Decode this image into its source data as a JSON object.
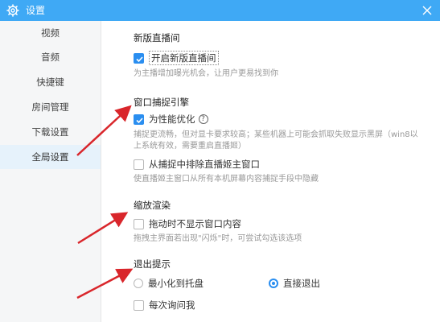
{
  "window": {
    "title": "设置",
    "title_icon": "gear-icon",
    "close_icon": "close-icon"
  },
  "sidebar": {
    "items": [
      {
        "label": "视频",
        "active": false
      },
      {
        "label": "音频",
        "active": false
      },
      {
        "label": "快捷键",
        "active": false
      },
      {
        "label": "房间管理",
        "active": false
      },
      {
        "label": "下载设置",
        "active": false
      },
      {
        "label": "全局设置",
        "active": true
      }
    ]
  },
  "sections": {
    "new_live": {
      "title": "新版直播间",
      "enable_label": "开启新版直播间",
      "enable_checked": true,
      "desc": "为主播增加曝光机会，让用户更易找到你"
    },
    "capture": {
      "title": "窗口捕捉引擎",
      "perf_label": "为性能优化",
      "perf_checked": true,
      "help_glyph": "?",
      "perf_desc": "捕捉更流畅，但对显卡要求较高；某些机器上可能会抓取失败显示黑屏（win8以上系统有效，需要重启直播姬）",
      "exclude_label": "从捕捉中排除直播姬主窗口",
      "exclude_checked": false,
      "exclude_desc": "使直播姬主窗口从所有本机屏幕内容捕捉手段中隐藏"
    },
    "scale": {
      "title": "缩放渲染",
      "drag_label": "拖动时不显示窗口内容",
      "drag_checked": false,
      "drag_desc": "拖拽主界面若出现\"闪烁\"时，可尝试勾选该选项"
    },
    "exit": {
      "title": "退出提示",
      "minimize_label": "最小化到托盘",
      "minimize_selected": false,
      "exit_label": "直接退出",
      "exit_selected": true,
      "ask_label": "每次询问我",
      "ask_checked": false
    }
  },
  "colors": {
    "titlebar": "#3fa9f5",
    "accent": "#2a8ef0",
    "arrow": "#d9262b"
  }
}
